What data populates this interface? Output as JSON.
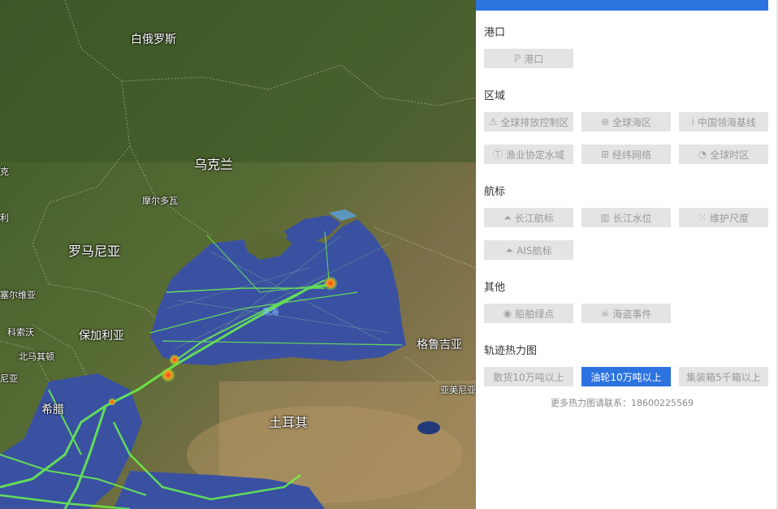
{
  "map": {
    "labels": {
      "belarus": "白俄罗斯",
      "ukraine": "乌克兰",
      "moldova": "摩尔多瓦",
      "romania": "罗马尼亚",
      "serbia": "塞尔维亚",
      "bulgaria": "保加利亚",
      "kosovo": "科索沃",
      "north_macedonia": "北马其顿",
      "greece": "希腊",
      "turkey": "土耳其",
      "georgia": "格鲁吉亚",
      "armenia": "亚美尼亚",
      "black_sea": "黑海",
      "edge_1": "克",
      "edge_2": "利",
      "edge_3": "尼亚"
    }
  },
  "panel": {
    "sections": {
      "port": {
        "title": "港口",
        "buttons": [
          {
            "label": "港口",
            "icon": "ℙ"
          }
        ]
      },
      "region": {
        "title": "区域",
        "buttons": [
          {
            "label": "全球排放控制区",
            "icon": "⚠"
          },
          {
            "label": "全球海区",
            "icon": "⊕"
          },
          {
            "label": "中国领海基线",
            "icon": "⁞"
          },
          {
            "label": "渔业协定水域",
            "icon": "Ⓣ"
          },
          {
            "label": "经纬网络",
            "icon": "⊞"
          },
          {
            "label": "全球时区",
            "icon": "◔"
          }
        ]
      },
      "beacon": {
        "title": "航标",
        "buttons": [
          {
            "label": "长江航标",
            "icon": "⏶"
          },
          {
            "label": "长江水位",
            "icon": "▥"
          },
          {
            "label": "维护尺度",
            "icon": "⁙"
          },
          {
            "label": "AIS航标",
            "icon": "⏶"
          }
        ]
      },
      "other": {
        "title": "其他",
        "buttons": [
          {
            "label": "船舶绿点",
            "icon": "◉"
          },
          {
            "label": "海盗事件",
            "icon": "☠"
          }
        ]
      },
      "heatmap": {
        "title": "轨迹热力图",
        "buttons": [
          {
            "label": "散货10万吨以上",
            "active": false
          },
          {
            "label": "油轮10万吨以上",
            "active": true
          },
          {
            "label": "集装箱5千箱以上",
            "active": false
          }
        ]
      }
    },
    "contact": "更多热力图请联系：18600225569",
    "colors": {
      "accent": "#2c73e0",
      "button_bg": "#e4e4e4",
      "button_text": "#9a9a9a"
    }
  }
}
